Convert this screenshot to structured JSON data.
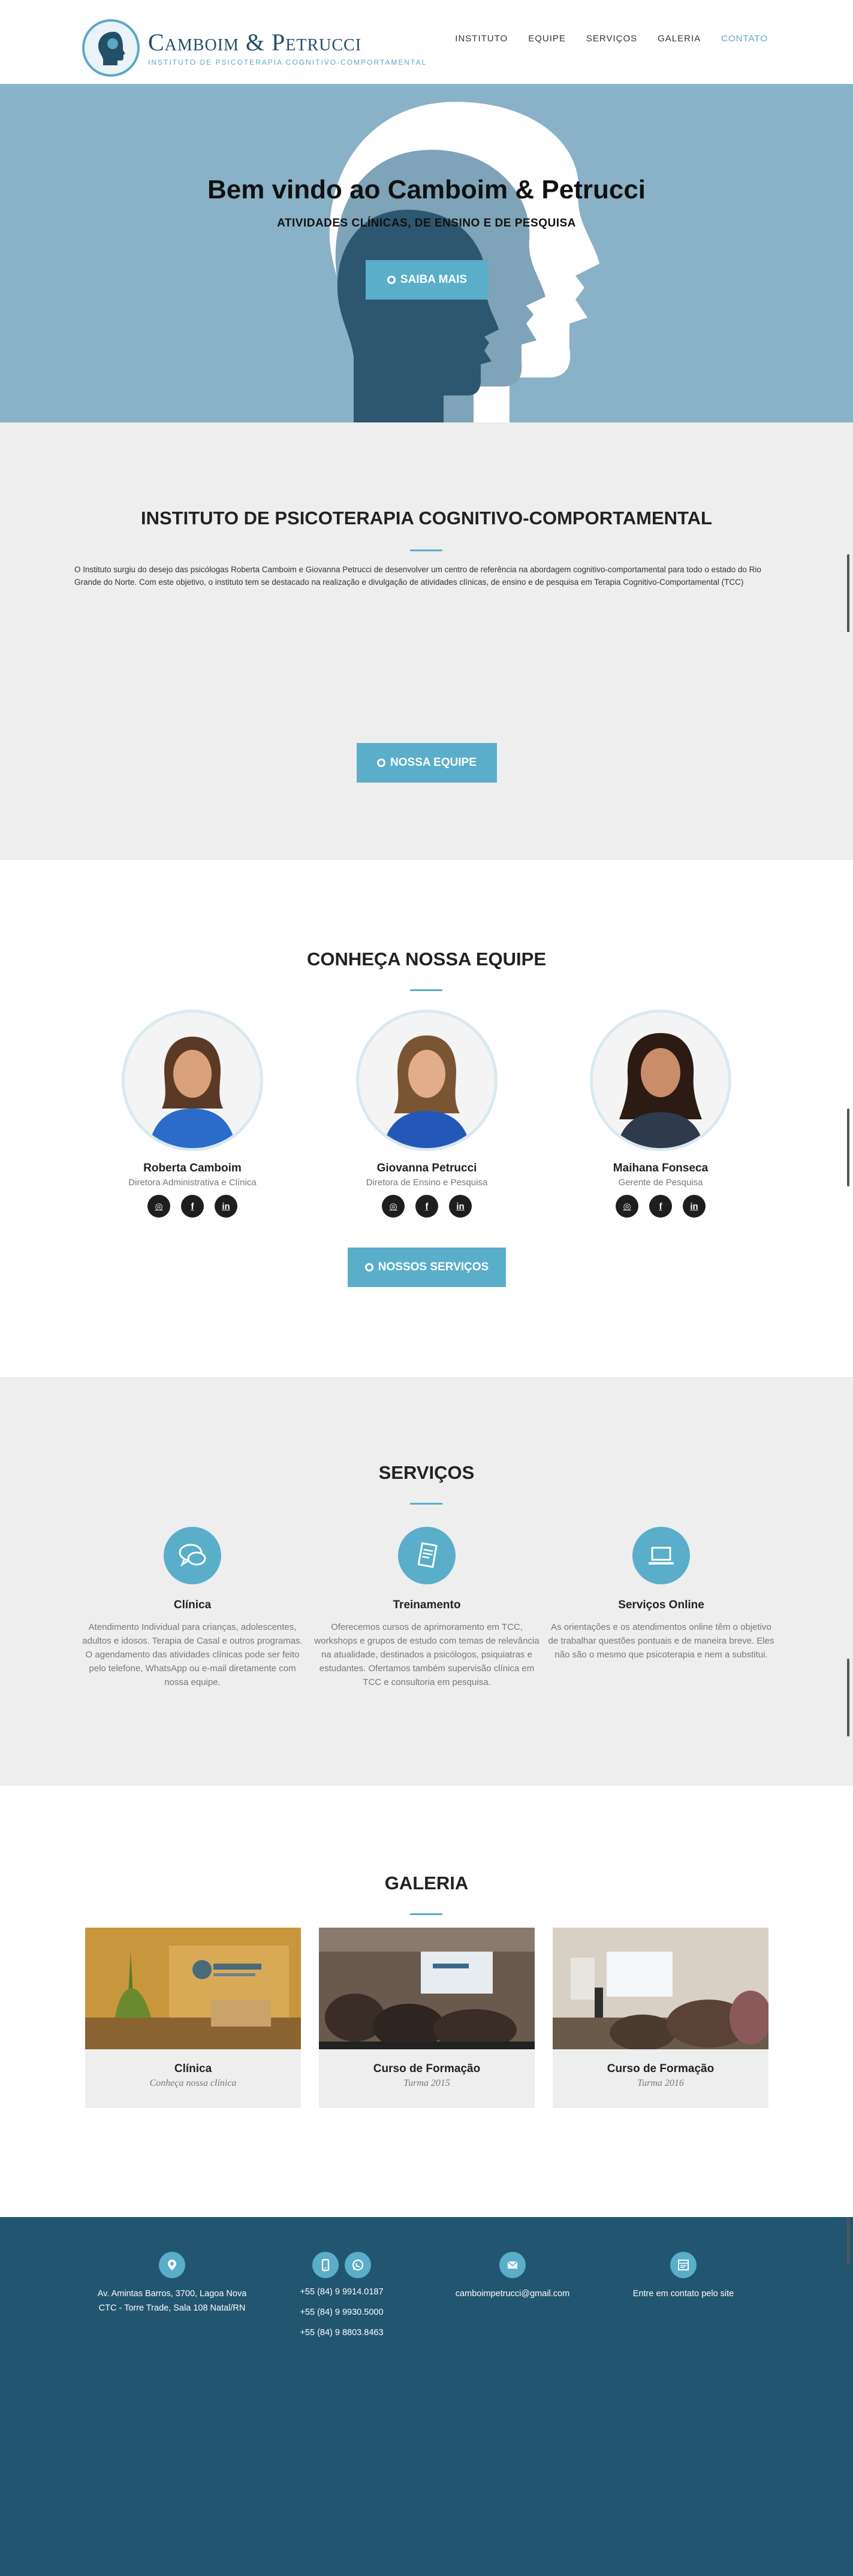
{
  "brand": {
    "name": "Camboim & Petrucci",
    "tagline": "INSTITUTO DE PSICOTERAPIA COGNITIVO-COMPORTAMENTAL"
  },
  "nav": [
    {
      "label": "INSTITUTO"
    },
    {
      "label": "EQUIPE"
    },
    {
      "label": "SERVIÇOS"
    },
    {
      "label": "GALERIA"
    },
    {
      "label": "CONTATO"
    }
  ],
  "hero": {
    "title": "Bem vindo ao Camboim & Petrucci",
    "subtitle": "ATIVIDADES CLÍNICAS, DE ENSINO E DE PESQUISA",
    "button": "SAIBA MAIS"
  },
  "instituto": {
    "title": "INSTITUTO DE PSICOTERAPIA COGNITIVO-COMPORTAMENTAL",
    "text": "O Instituto surgiu do desejo das psicólogas Roberta Camboim e Giovanna Petrucci de desenvolver um centro de referência na abordagem cognitivo-comportamental para todo o estado do Rio Grande do Norte. Com este objetivo, o instituto tem se destacado na realização e divulgação de atividades clínicas, de ensino e de pesquisa em Terapia Cognitivo-Comportamental (TCC)",
    "button": "NOSSA EQUIPE"
  },
  "equipe": {
    "title": "CONHEÇA NOSSA EQUIPE",
    "members": [
      {
        "name": "Roberta Camboim",
        "role": "Diretora Administrativa e Clínica"
      },
      {
        "name": "Giovanna Petrucci",
        "role": "Diretora de Ensino e Pesquisa"
      },
      {
        "name": "Maihana Fonseca",
        "role": "Gerente de Pesquisa"
      }
    ],
    "social_glyphs": {
      "instagram": "◎",
      "facebook": "f",
      "linkedin": "in"
    },
    "button": "NOSSOS SERVIÇOS"
  },
  "servicos": {
    "title": "SERVIÇOS",
    "items": [
      {
        "title": "Clínica",
        "icon": "chat-bubbles-icon",
        "text": "Atendimento Individual para crianças, adolescentes, adultos e idosos. Terapia de Casal e outros programas. O agendamento das atividades clínicas pode ser feito pelo telefone, WhatsApp ou e-mail diretamente com nossa equipe."
      },
      {
        "title": "Treinamento",
        "icon": "book-icon",
        "text": "Oferecemos cursos de aprimoramento em TCC, workshops e grupos de estudo com temas de relevância na atualidade, destinados a psicólogos, psiquiatras e estudantes. Ofertamos também supervisão clínica em TCC e consultoria em pesquisa."
      },
      {
        "title": "Serviços Online",
        "icon": "laptop-icon",
        "text": "As orientações e os atendimentos online têm o objetivo de trabalhar questões pontuais e de maneira breve. Eles não são o mesmo que psicoterapia e nem a substitui."
      }
    ]
  },
  "galeria": {
    "title": "GALERIA",
    "items": [
      {
        "title": "Clínica",
        "subtitle": "Conheça nossa clínica"
      },
      {
        "title": "Curso de Formação",
        "subtitle": "Turma 2015"
      },
      {
        "title": "Curso de Formação",
        "subtitle": "Turma 2016"
      }
    ]
  },
  "footer": {
    "address_line1": "Av. Amintas Barros, 3700, Lagoa Nova",
    "address_line2": "CTC - Torre Trade, Sala 108 Natal/RN",
    "phones": [
      "+55 (84) 9 9914.0187",
      "+55 (84) 9 9930.5000",
      "+55 (84) 9 8803.8463"
    ],
    "email": "camboimpetrucci@gmail.com",
    "contact_link": "Entre em contato pelo site"
  },
  "colors": {
    "accent": "#5aaec9",
    "hero_bg": "#89b1c7",
    "footer_bg": "#225670",
    "section_gray": "#eeeeee"
  }
}
